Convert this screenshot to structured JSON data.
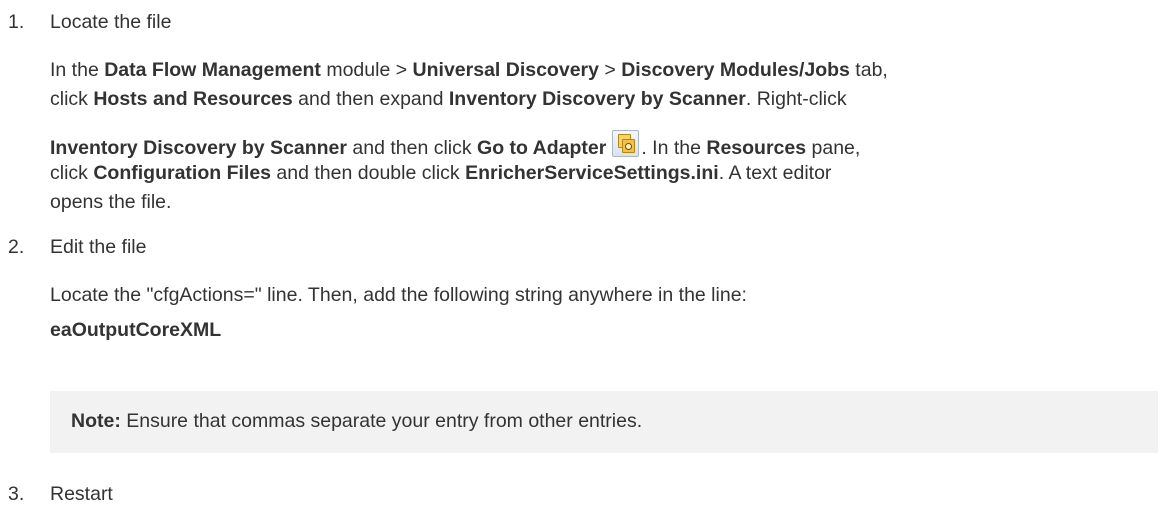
{
  "steps": [
    {
      "number": "1.",
      "title": "Locate the file",
      "para_line1": {
        "t1": "In the ",
        "b1": "Data Flow Management",
        "t2": " module > ",
        "b2": "Universal Discovery",
        "t3": " > ",
        "b3": "Discovery Modules/Jobs",
        "t4": " tab,"
      },
      "para_line2": {
        "t1": "click ",
        "b1": "Hosts and Resources",
        "t2": " and then expand ",
        "b2": "Inventory Discovery by Scanner",
        "t3": ". Right-click"
      },
      "para_line3": {
        "b1": "Inventory Discovery by Scanner",
        "t1": " and then click ",
        "b2": "Go to Adapter",
        "icon": "go-to-adapter-icon",
        "t2": ". In the ",
        "b3": "Resources",
        "t3": " pane,"
      },
      "para_line4": {
        "t1": "click ",
        "b1": "Configuration Files",
        "t2": " and then double click ",
        "b2": "EnricherServiceSettings.ini",
        "t3": ". A text editor"
      },
      "para_line5": {
        "t1": "opens the file."
      }
    },
    {
      "number": "2.",
      "title": "Edit the file",
      "para_line1": "Locate the \"cfgActions=\" line. Then, add the following string anywhere in the line:",
      "code": "eaOutputCoreXML",
      "note_label": "Note:",
      "note_text": " Ensure that commas separate your entry from other entries."
    },
    {
      "number": "3.",
      "title": "Restart"
    }
  ]
}
